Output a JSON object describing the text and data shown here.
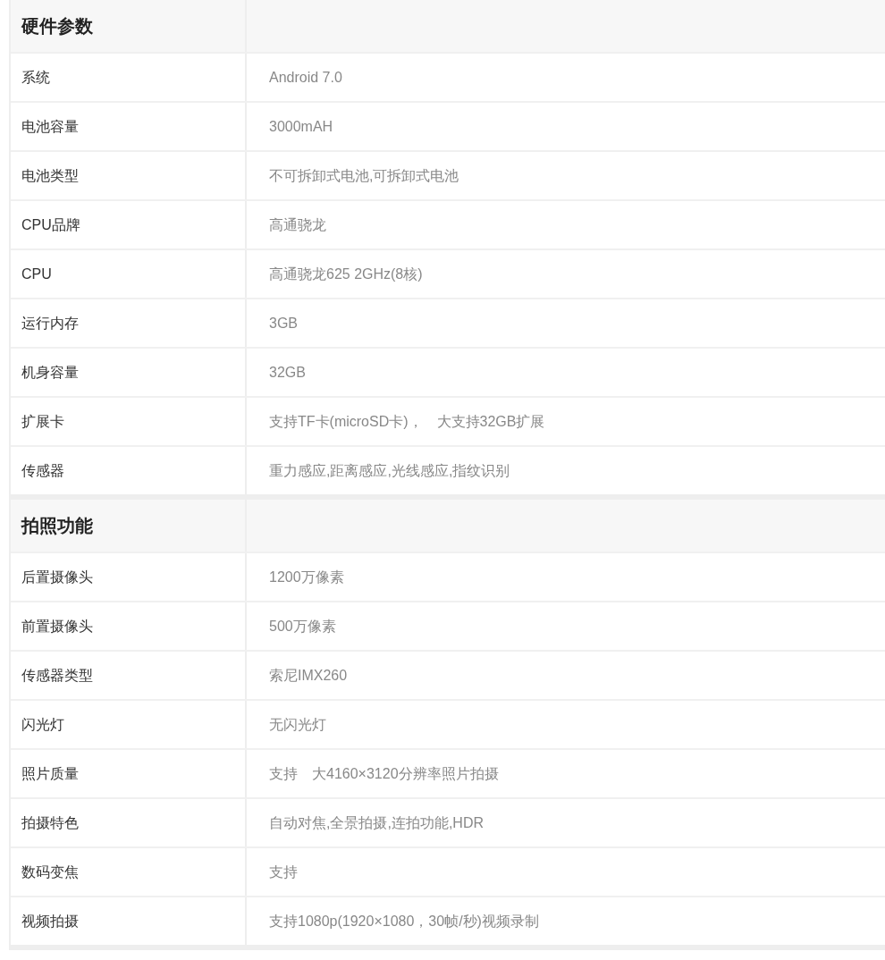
{
  "sections": [
    {
      "title": "硬件参数",
      "rows": [
        {
          "label": "系统",
          "value": "Android 7.0"
        },
        {
          "label": "电池容量",
          "value": "3000mAH"
        },
        {
          "label": "电池类型",
          "value": "不可拆卸式电池,可拆卸式电池"
        },
        {
          "label": "CPU品牌",
          "value": "高通骁龙"
        },
        {
          "label": "CPU",
          "value": "高通骁龙625 2GHz(8核)"
        },
        {
          "label": "运行内存",
          "value": "3GB"
        },
        {
          "label": "机身容量",
          "value": "32GB"
        },
        {
          "label": "扩展卡",
          "value": "支持TF卡(microSD卡)，　大支持32GB扩展"
        },
        {
          "label": "传感器",
          "value": "重力感应,距离感应,光线感应,指纹识别"
        }
      ]
    },
    {
      "title": "拍照功能",
      "rows": [
        {
          "label": "后置摄像头",
          "value": "1200万像素"
        },
        {
          "label": "前置摄像头",
          "value": "500万像素"
        },
        {
          "label": "传感器类型",
          "value": "索尼IMX260"
        },
        {
          "label": "闪光灯",
          "value": "无闪光灯"
        },
        {
          "label": "照片质量",
          "value": "支持　大4160×3120分辨率照片拍摄"
        },
        {
          "label": "拍摄特色",
          "value": "自动对焦,全景拍摄,连拍功能,HDR"
        },
        {
          "label": "数码变焦",
          "value": "支持"
        },
        {
          "label": "视频拍摄",
          "value": "支持1080p(1920×1080，30帧/秒)视频录制"
        }
      ]
    }
  ]
}
